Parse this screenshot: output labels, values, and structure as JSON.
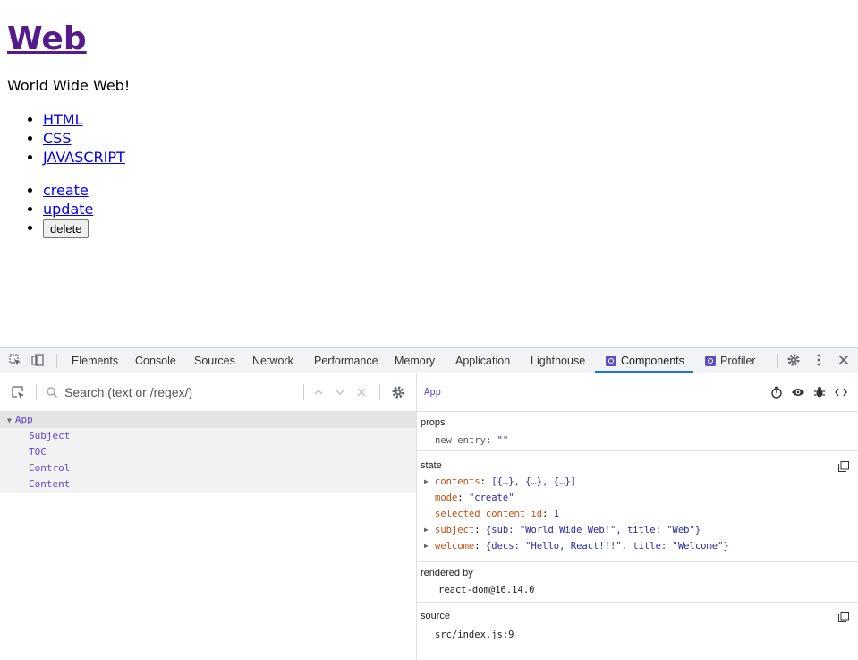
{
  "page": {
    "title": "Web",
    "subtitle": "World Wide Web!",
    "toc": [
      "HTML",
      "CSS",
      "JAVASCRIPT"
    ],
    "controls": {
      "create": "create",
      "update": "update",
      "delete": "delete"
    }
  },
  "devtools": {
    "tabs": [
      "Elements",
      "Console",
      "Sources",
      "Network",
      "Performance",
      "Memory",
      "Application",
      "Lighthouse",
      "Components",
      "Profiler"
    ],
    "active_tab": "Components",
    "search": {
      "placeholder": "Search (text or /regex/)"
    },
    "tree": [
      "App",
      "Subject",
      "TOC",
      "Control",
      "Content"
    ],
    "selected_component": "App",
    "props": {
      "title": "props",
      "items": [
        {
          "key": "new entry",
          "value": "\"\""
        }
      ]
    },
    "state": {
      "title": "state",
      "items": [
        {
          "key": "contents",
          "value": "[{…}, {…}, {…}]"
        },
        {
          "key": "mode",
          "value": "\"create\""
        },
        {
          "key": "selected_content_id",
          "value": "1"
        },
        {
          "key": "subject",
          "value": "{sub: \"World Wide Web!\", title: \"Web\"}"
        },
        {
          "key": "welcome",
          "value": "{decs: \"Hello, React!!!\", title: \"Welcome\"}"
        }
      ]
    },
    "rendered_by": {
      "title": "rendered by",
      "value": "react-dom@16.14.0"
    },
    "source": {
      "title": "source",
      "value": "src/index.js:9"
    }
  },
  "colors": {
    "visited_link": "#551a8b",
    "link": "#0000ee",
    "component_name": "#6446c8",
    "state_key": "#c24e14",
    "state_value": "#2b2ba0",
    "active_tab_underline": "#1a73e8"
  }
}
